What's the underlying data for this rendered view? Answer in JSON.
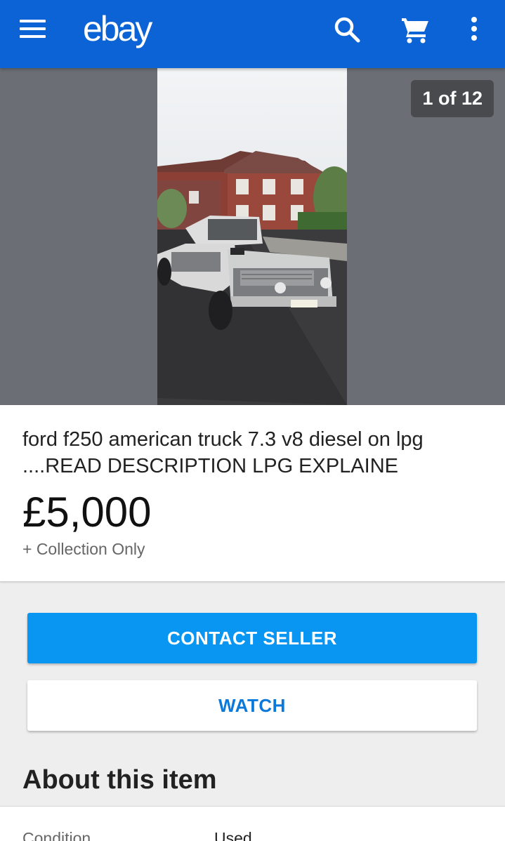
{
  "header": {
    "logo": "ebay",
    "icons": [
      "menu-icon",
      "search-icon",
      "cart-icon",
      "more-vert-icon"
    ],
    "background": "#0b63d6"
  },
  "gallery": {
    "counter": "1 of 12",
    "image_alt": "White and grey Ford pickup truck parked on a residential street"
  },
  "listing": {
    "title": "ford f250 american truck 7.3 v8 diesel on lpg ....READ DESCRIPTION  LPG EXPLAINE",
    "price": "£5,000",
    "shipping": "+ Collection Only"
  },
  "actions": {
    "contact_seller": "CONTACT SELLER",
    "watch": "WATCH"
  },
  "about": {
    "heading": "About this item",
    "rows": [
      {
        "label": "Condition",
        "value": "Used"
      }
    ]
  },
  "colors": {
    "primary_button": "#0995f2",
    "link_blue": "#0b79d9"
  }
}
